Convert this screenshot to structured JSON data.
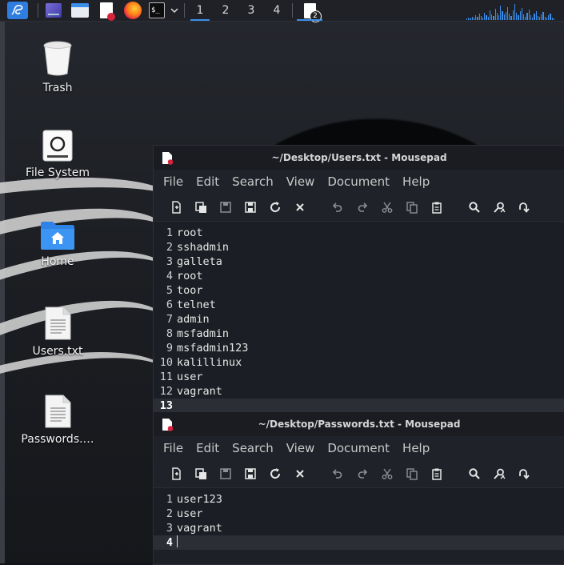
{
  "panel": {
    "workspaces": [
      "1",
      "2",
      "3",
      "4"
    ],
    "active_workspace": "1",
    "task_badge": "2",
    "accent": "#3b8eea"
  },
  "desktop_icons": [
    {
      "label": "Trash",
      "icon": "trash-icon"
    },
    {
      "label": "File System",
      "icon": "drive-icon"
    },
    {
      "label": "Home",
      "icon": "home-folder-icon"
    },
    {
      "label": "Users.txt",
      "icon": "text-file-icon"
    },
    {
      "label": "Passwords.…",
      "icon": "text-file-icon"
    }
  ],
  "menu": [
    "File",
    "Edit",
    "Search",
    "View",
    "Document",
    "Help"
  ],
  "toolbar_icons": [
    "new-document-icon",
    "new-window-icon",
    "save-icon",
    "save-as-icon",
    "reload-icon",
    "close-icon",
    "undo-icon",
    "redo-icon",
    "cut-icon",
    "copy-icon",
    "paste-icon",
    "search-icon",
    "replace-icon",
    "go-to-line-icon"
  ],
  "windows": [
    {
      "title": "~/Desktop/Users.txt - Mousepad",
      "lines": [
        "root",
        "sshadmin",
        "galleta",
        "root",
        "toor",
        "telnet",
        "admin",
        "msfadmin",
        "msfadmin123",
        "kalillinux",
        "user",
        "vagrant",
        ""
      ],
      "current_line": 13
    },
    {
      "title": "~/Desktop/Passwords.txt - Mousepad",
      "lines": [
        "user123",
        "user",
        "vagrant",
        ""
      ],
      "current_line": 4
    }
  ]
}
